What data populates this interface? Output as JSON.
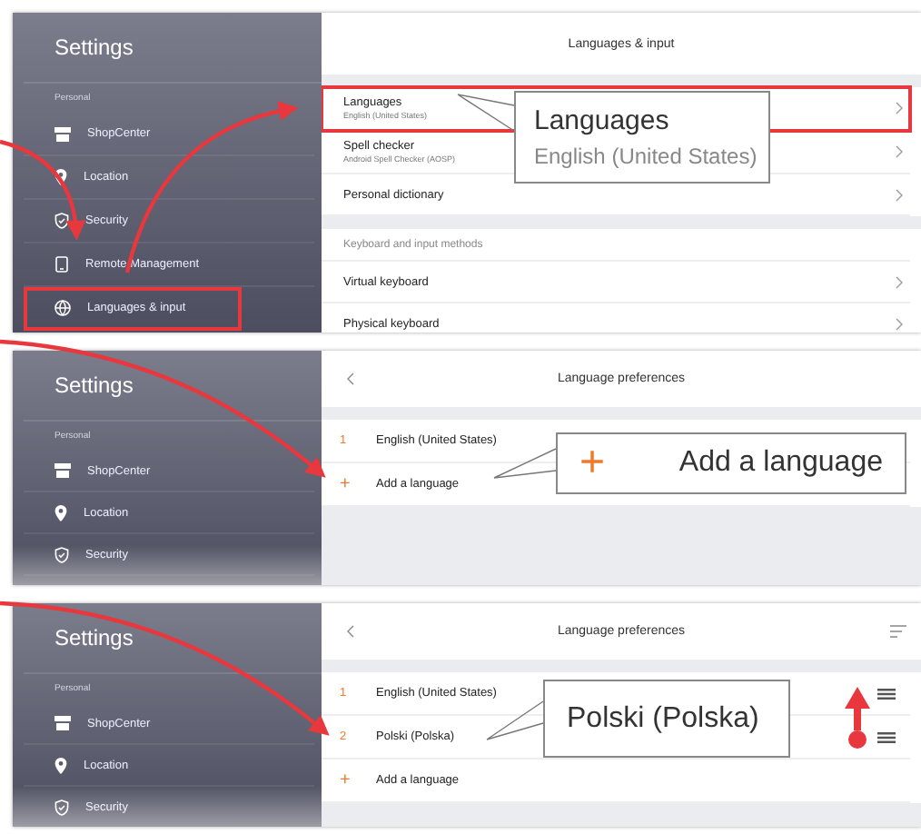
{
  "panels": [
    {
      "kind": "languages_input",
      "sidebar": {
        "title": "Settings",
        "section": "Personal",
        "items": [
          {
            "label": "ShopCenter",
            "highlighted": false
          },
          {
            "label": "Location",
            "highlighted": false
          },
          {
            "label": "Security",
            "highlighted": false
          },
          {
            "label": "Remote Management",
            "highlighted": false
          },
          {
            "label": "Languages & input",
            "highlighted": true
          }
        ]
      },
      "header": {
        "title": "Languages & input"
      },
      "groups": [
        {
          "rows": [
            {
              "title": "Languages",
              "subtitle": "English (United States)",
              "highlighted": true
            },
            {
              "title": "Spell checker",
              "subtitle": "Android Spell Checker (AOSP)",
              "highlighted": false
            },
            {
              "title": "Personal dictionary",
              "highlighted": false
            }
          ]
        },
        {
          "heading": "Keyboard and input methods",
          "rows": [
            {
              "title": "Virtual keyboard",
              "highlighted": false
            },
            {
              "title": "Physical keyboard",
              "highlighted": false
            }
          ]
        }
      ],
      "callout": {
        "title": "Languages",
        "subtitle": "English (United States)"
      }
    },
    {
      "kind": "language_preferences",
      "sidebar": {
        "title": "Settings",
        "section": "Personal",
        "items": [
          {
            "label": "ShopCenter",
            "highlighted": false
          },
          {
            "label": "Location",
            "highlighted": false
          },
          {
            "label": "Security",
            "highlighted": false
          }
        ]
      },
      "header": {
        "title": "Language preferences",
        "sort_menu": false
      },
      "languages": [
        {
          "number": "1",
          "name": "English (United States)"
        }
      ],
      "add_row": {
        "symbol": "+",
        "label": "Add a language"
      },
      "reorderable": false,
      "callout": {
        "symbol": "+",
        "title": "Add a language"
      }
    },
    {
      "kind": "language_preferences",
      "sidebar": {
        "title": "Settings",
        "section": "Personal",
        "items": [
          {
            "label": "ShopCenter",
            "highlighted": false
          },
          {
            "label": "Location",
            "highlighted": false
          },
          {
            "label": "Security",
            "highlighted": false
          }
        ]
      },
      "header": {
        "title": "Language preferences",
        "sort_menu": true
      },
      "languages": [
        {
          "number": "1",
          "name": "English (United States)"
        },
        {
          "number": "2",
          "name": "Polski (Polska)"
        }
      ],
      "add_row": {
        "symbol": "+",
        "label": "Add a language"
      },
      "reorderable": true,
      "callout": {
        "title": "Polski (Polska)"
      }
    }
  ]
}
